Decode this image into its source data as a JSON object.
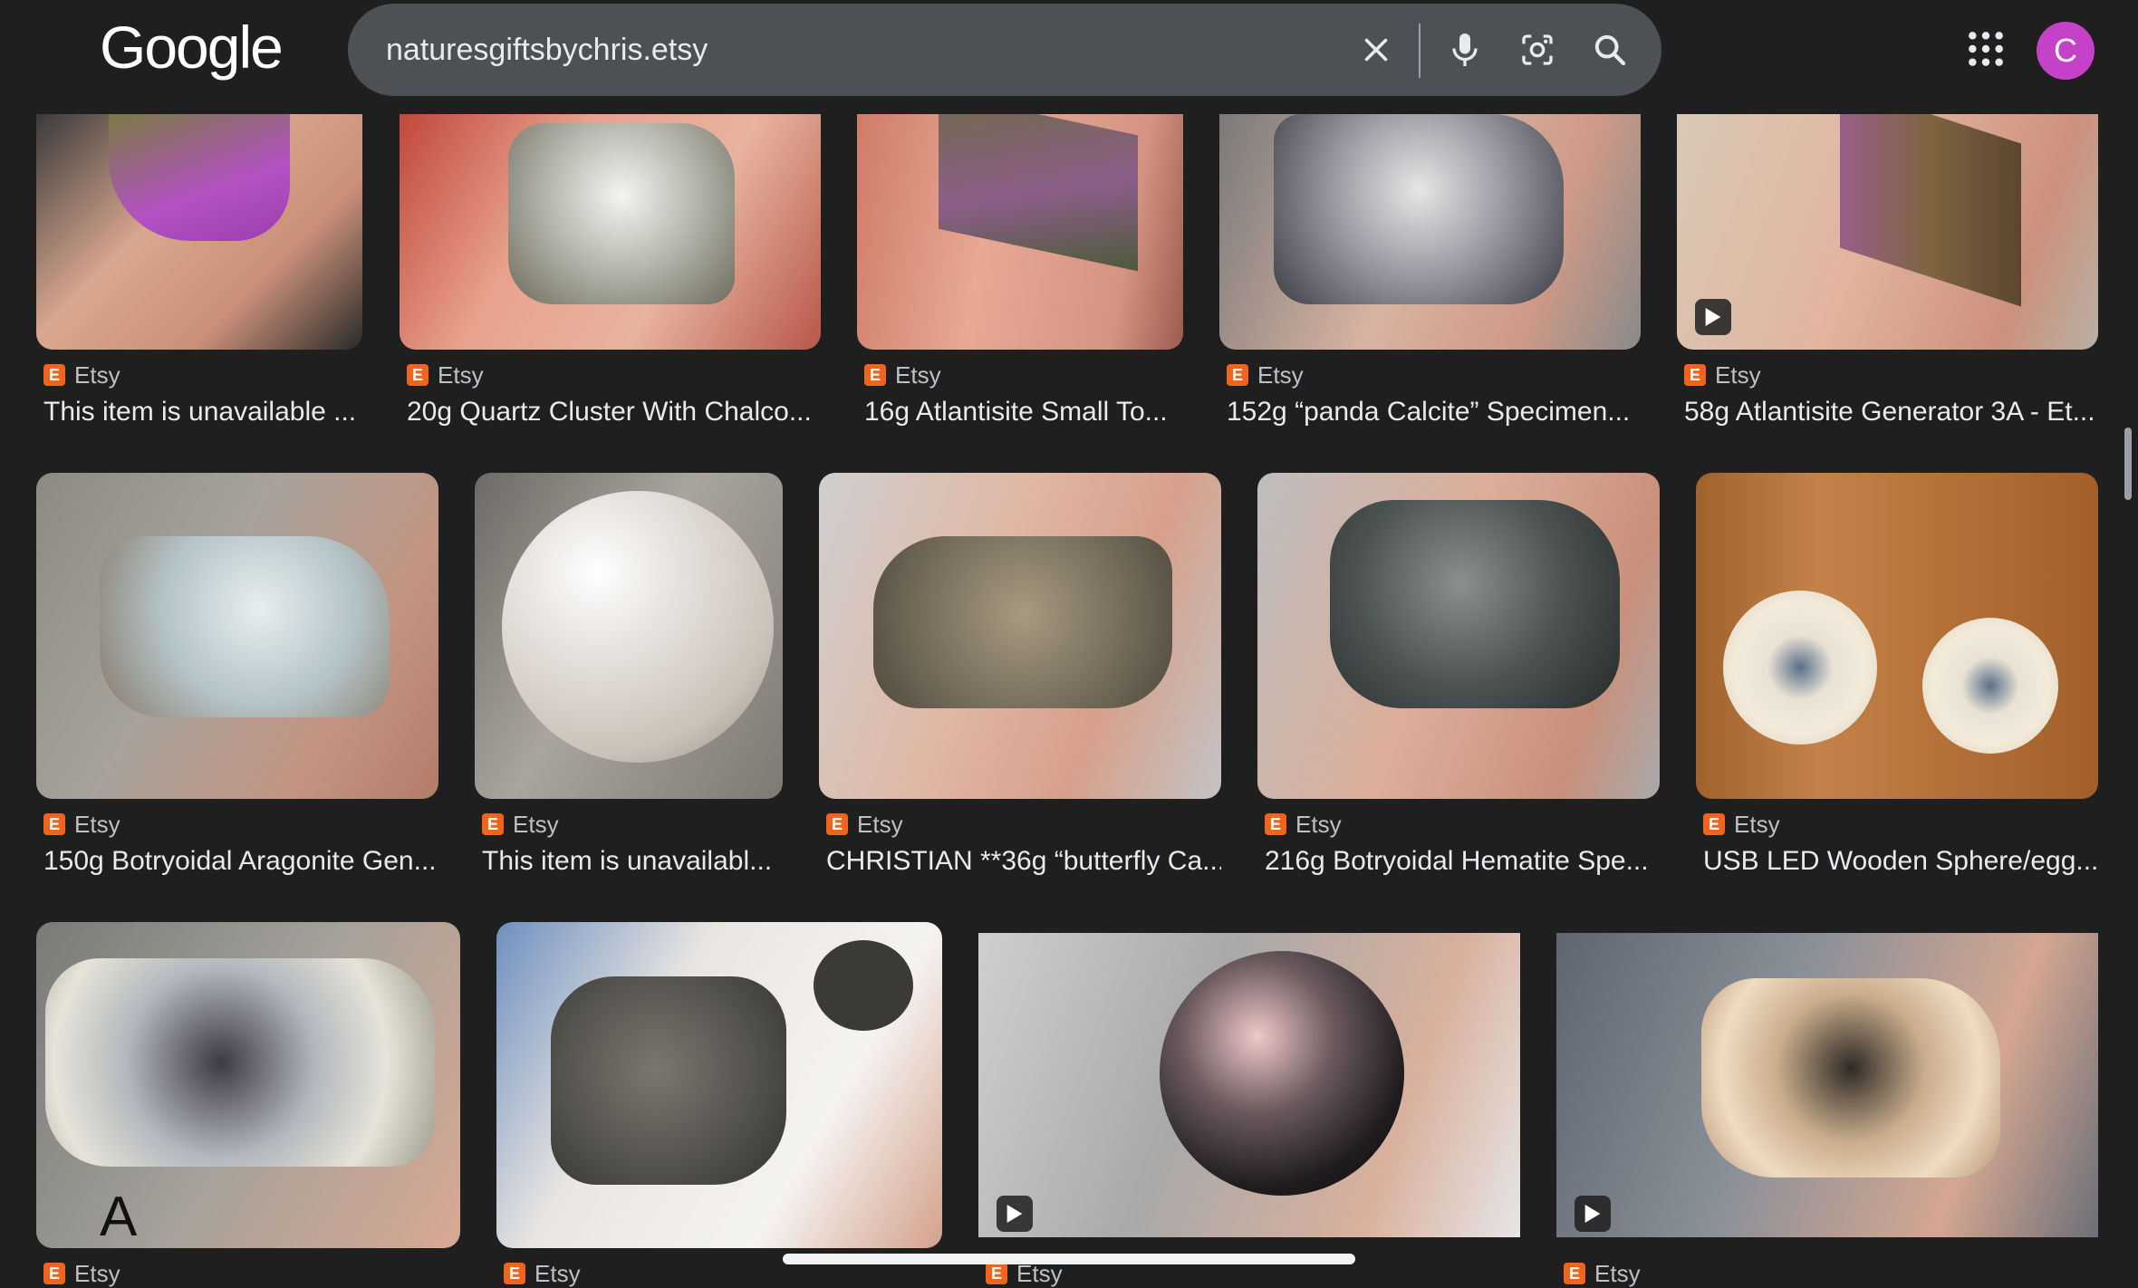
{
  "header": {
    "logo": "Google",
    "search_value": "naturesgiftsbychris.etsy",
    "avatar_initial": "C"
  },
  "results": {
    "row1": [
      {
        "source": "Etsy",
        "title": "This item is unavailable ..."
      },
      {
        "source": "Etsy",
        "title": "20g Quartz Cluster With Chalco..."
      },
      {
        "source": "Etsy",
        "title": "16g Atlantisite Small To..."
      },
      {
        "source": "Etsy",
        "title": "152g “panda Calcite” Specimen..."
      },
      {
        "source": "Etsy",
        "title": "58g Atlantisite Generator 3A - Et..."
      }
    ],
    "row2": [
      {
        "source": "Etsy",
        "title": "150g Botryoidal Aragonite Gen..."
      },
      {
        "source": "Etsy",
        "title": "This item is unavailabl..."
      },
      {
        "source": "Etsy",
        "title": "CHRISTIAN **36g “butterfly Ca..."
      },
      {
        "source": "Etsy",
        "title": "216g Botryoidal Hematite Spe..."
      },
      {
        "source": "Etsy",
        "title": "USB LED Wooden Sphere/egg..."
      }
    ],
    "row3": [
      {
        "source": "Etsy"
      },
      {
        "source": "Etsy"
      },
      {
        "source": "Etsy"
      },
      {
        "source": "Etsy"
      }
    ],
    "thumb_letter": "A"
  }
}
